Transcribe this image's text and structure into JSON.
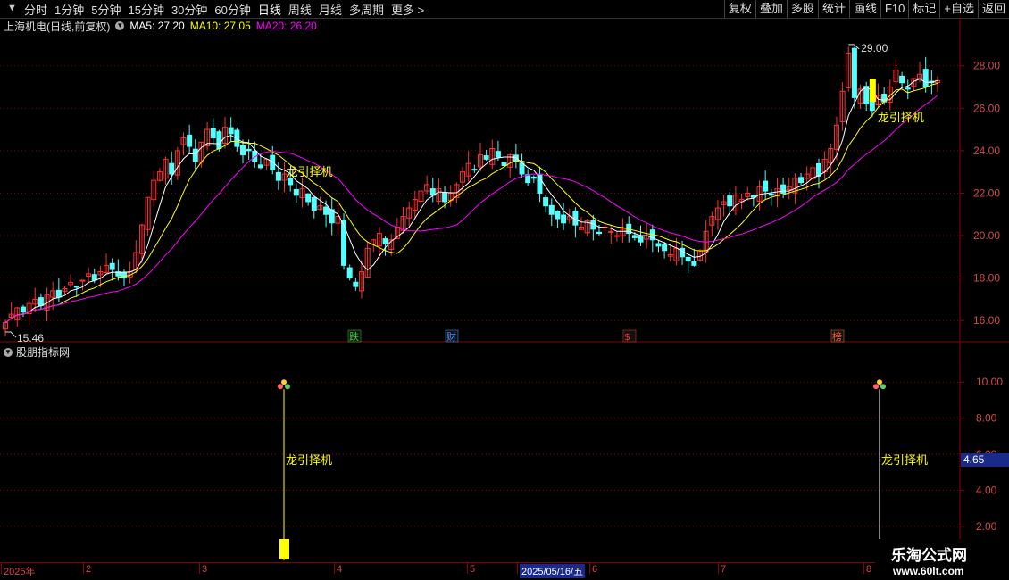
{
  "toolbar": {
    "left_items": [
      "分时",
      "1分钟",
      "5分钟",
      "15分钟",
      "30分钟",
      "60分钟",
      "日线",
      "周线",
      "月线",
      "多周期",
      "更多 >"
    ],
    "active_item": "日线",
    "right_items": [
      "复权",
      "叠加",
      "多股",
      "统计",
      "画线",
      "F10",
      "标记",
      "+自选",
      "返回"
    ]
  },
  "header": {
    "stock_title": "上海机电(日线,前复权)",
    "ma5_label": "MA5: 27.20",
    "ma10_label": "MA10: 27.05",
    "ma20_label": "MA20: 26.20"
  },
  "indicator_panel": {
    "title": "股朋指标网",
    "current_value": "4.65"
  },
  "watermark": {
    "line1": "乐淘公式网",
    "line2": "www.60lt.com"
  },
  "colors": {
    "up": "#ff3232",
    "down": "#54ffff",
    "ma5": "#ffffff",
    "ma10": "#ffff00",
    "ma20": "#ff00ff",
    "grid": "#8b0000",
    "signal": "#ffff00",
    "axis_text": "#d24a4a"
  },
  "chart_data": [
    {
      "type": "candlestick",
      "title": "上海机电(日线,前复权)",
      "ylim": [
        15,
        29.5
      ],
      "yticks": [
        "16.00",
        "18.00",
        "20.00",
        "22.00",
        "24.00",
        "26.00",
        "28.00"
      ],
      "series": [
        {
          "name": "MA5",
          "values": [
            27.2
          ]
        },
        {
          "name": "MA10",
          "values": [
            27.05
          ]
        },
        {
          "name": "MA20",
          "values": [
            26.2
          ]
        }
      ],
      "extremes": {
        "high": "29.00",
        "low": "15.46"
      },
      "annotations": [
        "龙引择机",
        "龙引择机"
      ],
      "event_markers": [
        "跌",
        "财",
        "$",
        "榜"
      ],
      "x_labels": [
        "2025年",
        "2",
        "3",
        "4",
        "5",
        "2025/05/16/五",
        "6",
        "7",
        "8"
      ],
      "closes": [
        15.9,
        16.3,
        16.6,
        16.4,
        16.8,
        17.0,
        16.7,
        17.2,
        17.4,
        17.1,
        17.5,
        17.8,
        17.6,
        17.9,
        18.2,
        17.9,
        18.3,
        18.6,
        18.4,
        18.1,
        18.0,
        18.3,
        19.2,
        20.5,
        21.8,
        22.6,
        23.0,
        23.6,
        22.9,
        24.0,
        24.6,
        24.2,
        23.5,
        24.4,
        25.0,
        24.6,
        24.1,
        25.1,
        24.8,
        24.2,
        23.8,
        24.0,
        23.5,
        23.2,
        23.6,
        23.1,
        22.6,
        22.9,
        22.4,
        21.9,
        22.2,
        21.6,
        21.2,
        21.4,
        21.0,
        20.6,
        20.9,
        18.6,
        18.0,
        17.6,
        18.3,
        19.4,
        19.8,
        20.1,
        19.6,
        19.8,
        20.4,
        20.9,
        21.3,
        21.7,
        22.1,
        22.4,
        21.9,
        22.2,
        21.6,
        22.0,
        22.4,
        23.0,
        23.4,
        23.1,
        23.8,
        23.6,
        24.1,
        23.7,
        23.3,
        23.8,
        23.5,
        22.9,
        22.5,
        22.7,
        22.0,
        21.4,
        21.0,
        20.8,
        20.6,
        20.9,
        20.5,
        20.4,
        20.7,
        20.3,
        20.1,
        20.4,
        20.2,
        20.0,
        20.3,
        20.1,
        19.9,
        19.7,
        20.0,
        19.8,
        19.5,
        19.3,
        19.1,
        19.4,
        19.0,
        18.8,
        18.6,
        19.3,
        20.2,
        20.9,
        21.3,
        21.6,
        21.4,
        21.9,
        21.7,
        22.0,
        21.8,
        22.3,
        22.1,
        21.9,
        22.2,
        22.0,
        22.3,
        22.7,
        22.5,
        22.9,
        23.2,
        22.8,
        23.6,
        24.1,
        25.2,
        26.8,
        28.6,
        26.5,
        26.9,
        26.2,
        25.9,
        26.6,
        26.3,
        27.0,
        27.8,
        27.2,
        26.9,
        27.4,
        27.6,
        27.0,
        27.2,
        27.3
      ],
      "indicator_panel": {
        "title": "股朋指标网",
        "ylim": [
          1,
          11
        ],
        "yticks": [
          "2.00",
          "4.00",
          "6.00",
          "8.00",
          "10.00"
        ],
        "current_value": "4.65",
        "signals": [
          {
            "label": "龙引择机",
            "value": 10
          },
          {
            "label": "龙引择机",
            "value": 10
          }
        ]
      }
    }
  ]
}
